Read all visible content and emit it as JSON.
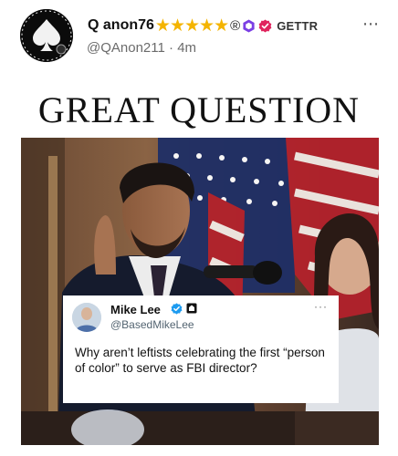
{
  "post": {
    "author": {
      "display_name": "Q anon76",
      "star_count": 5,
      "registered_mark": "®",
      "platform": "GETTR",
      "handle": "@QAnon211",
      "separator": "·",
      "time_ago": "4m"
    },
    "more_icon": "⋯",
    "title": "GREAT QUESTION",
    "image": {
      "embedded_tweet": {
        "name": "Mike Lee",
        "handle": "@BasedMikeLee",
        "more_icon": "···",
        "text": "Why aren’t leftists celebrating the first “person of color” to serve as FBI director?"
      }
    }
  },
  "colors": {
    "star": "#f4b400",
    "hex_badge": "#7b3fe4",
    "verified_badge": "#e0245e",
    "tweet_verified": "#1d9bf0"
  },
  "icons": {
    "avatar": "spade-avatar-icon",
    "star": "star-icon",
    "hex_badge": "hexagon-badge-icon",
    "verified": "verified-badge-icon",
    "more": "more-dots-icon",
    "tweet_verified": "tweet-verified-icon",
    "tweet_affiliation": "affiliation-square-icon"
  }
}
